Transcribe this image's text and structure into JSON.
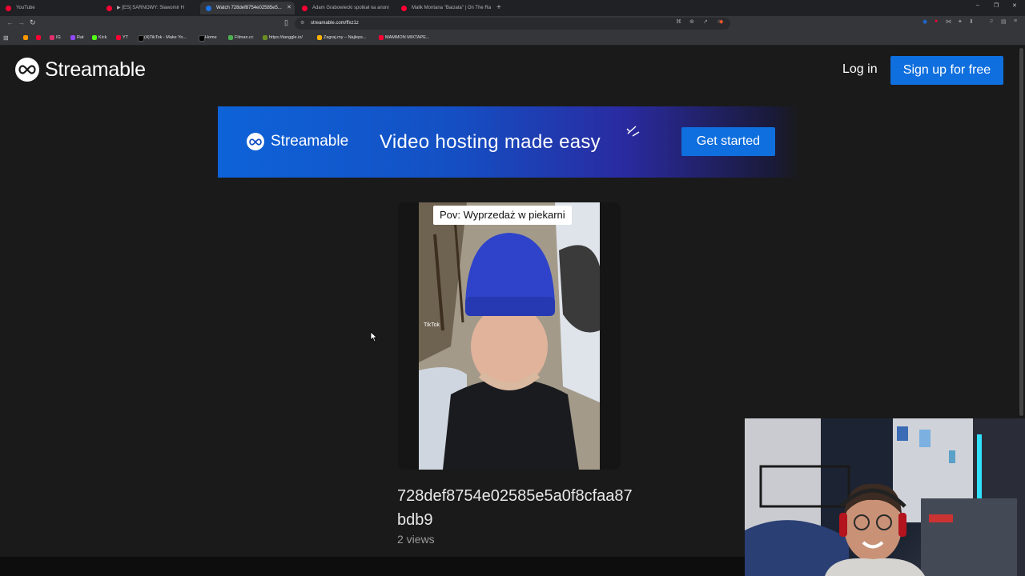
{
  "browser": {
    "tabs": [
      {
        "label": "YouTube",
        "favicon_color": "#ff0033",
        "active": false
      },
      {
        "label": "▶ [ES] SARNOWY: Sławomir H",
        "favicon_color": "#ff0033",
        "active": false
      },
      {
        "label": "Watch 728def8754e02585e5...",
        "favicon_color": "#1a73e8",
        "active": true
      },
      {
        "label": "Adam Grabowiecki spotkał na anoni",
        "favicon_color": "#ff0033",
        "active": false
      },
      {
        "label": "Malik Montana \"Baciata\" | On The Ra",
        "favicon_color": "#ff0033",
        "active": false
      }
    ],
    "new_tab": "+",
    "window_controls": [
      "–",
      "❐",
      "✕"
    ],
    "url": "streamable.com/ffxz1z",
    "bookmarks": [
      {
        "label": "",
        "color": "#ff9800"
      },
      {
        "label": "",
        "color": "#ff0033"
      },
      {
        "label": "IG",
        "color": "#e1306c"
      },
      {
        "label": "Rat",
        "color": "#9146ff"
      },
      {
        "label": "Kick",
        "color": "#53fc18"
      },
      {
        "label": "YT",
        "color": "#ff0033"
      },
      {
        "label": "(4)TikTok - Make Yo...",
        "color": "#000000"
      },
      {
        "label": "Home",
        "color": "#000000"
      },
      {
        "label": "Filman.cc",
        "color": "#4caf50"
      },
      {
        "label": "https://tanggle.io/",
        "color": "#6b8e23"
      },
      {
        "label": "Zagraj.my – Najleps...",
        "color": "#ffb300"
      },
      {
        "label": "MAMMON MIXTAPE...",
        "color": "#ff0033"
      }
    ]
  },
  "site": {
    "logo_text": "Streamable",
    "login": "Log in",
    "signup": "Sign up for free"
  },
  "banner": {
    "logo_text": "Streamable",
    "tagline": "Video hosting made easy",
    "cta": "Get started"
  },
  "video": {
    "caption": "Pov: Wyprzedaż w piekarni",
    "watermark": "TikTok",
    "title": "728def8754e02585e5a0f8cfaa87bdb9",
    "views": "2 views"
  }
}
